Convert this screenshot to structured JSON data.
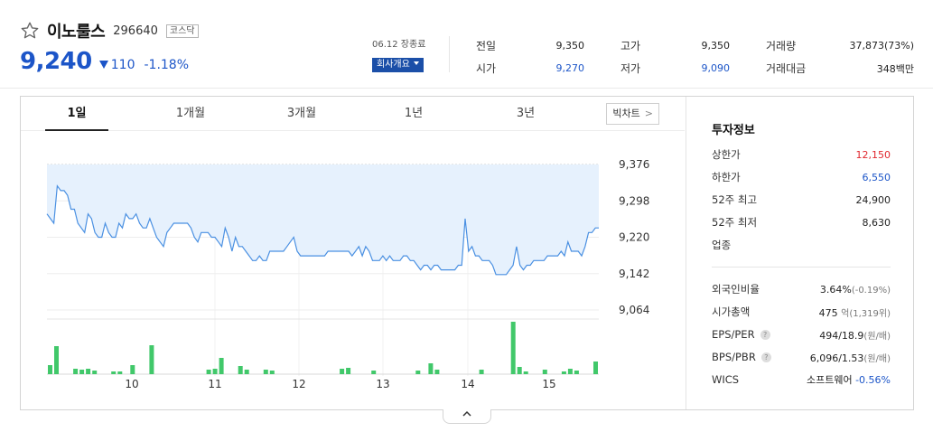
{
  "stock": {
    "name": "이노룰스",
    "code": "296640",
    "market": "코스닥",
    "price": "9,240",
    "change": "110",
    "change_pct": "-1.18%",
    "time": "06.12 장종료",
    "corp_info_label": "회사개요"
  },
  "summary": {
    "left": [
      {
        "label": "전일",
        "value": "9,350"
      },
      {
        "label": "시가",
        "value": "9,270"
      }
    ],
    "mid": [
      {
        "label": "고가",
        "value": "9,350"
      },
      {
        "label": "저가",
        "value": "9,090"
      }
    ],
    "right": [
      {
        "label": "거래량",
        "value": "37,873(73%)"
      },
      {
        "label": "거래대금",
        "value": "348백만"
      }
    ]
  },
  "tabs": [
    "1일",
    "1개월",
    "3개월",
    "1년",
    "3년"
  ],
  "big_chart_label": "빅차트",
  "invest": {
    "title": "투자정보",
    "rows": [
      {
        "label": "상한가",
        "value": "12,150"
      },
      {
        "label": "하한가",
        "value": "6,550"
      },
      {
        "label": "52주 최고",
        "value": "24,900"
      },
      {
        "label": "52주 최저",
        "value": "8,630"
      },
      {
        "label": "업종",
        "value": ""
      }
    ],
    "rows2": [
      {
        "label": "외국인비율",
        "value": "3.64%",
        "sub": "(-0.19%)"
      },
      {
        "label": "시가총액",
        "value": "475",
        "sub": "억(1,319위)"
      },
      {
        "label": "EPS/PER",
        "value": "494/18.9",
        "sub": "(원/배)"
      },
      {
        "label": "BPS/PBR",
        "value": "6,096/1.53",
        "sub": "(원/배)"
      },
      {
        "label": "WICS",
        "value": "소프트웨어",
        "sub2": "-0.56%"
      }
    ]
  },
  "colors": {
    "accent": "#1c55c8",
    "up": "#e0262d",
    "line": "#4a90e2",
    "fill": "#e6f1fd",
    "volume": "#41c86a"
  },
  "chart_data": {
    "type": "line",
    "x_labels": [
      "10",
      "11",
      "12",
      "13",
      "14",
      "15"
    ],
    "y_ticks": [
      "9,376",
      "9,298",
      "9,220",
      "9,142",
      "9,064"
    ],
    "ylim": [
      9064,
      9376
    ],
    "price_series": [
      9270,
      9260,
      9250,
      9330,
      9320,
      9320,
      9310,
      9280,
      9280,
      9250,
      9240,
      9230,
      9270,
      9260,
      9230,
      9220,
      9220,
      9250,
      9230,
      9220,
      9220,
      9250,
      9240,
      9270,
      9260,
      9260,
      9270,
      9250,
      9240,
      9240,
      9260,
      9240,
      9220,
      9210,
      9200,
      9230,
      9240,
      9250,
      9250,
      9250,
      9250,
      9250,
      9240,
      9220,
      9210,
      9230,
      9230,
      9230,
      9220,
      9220,
      9210,
      9200,
      9240,
      9220,
      9190,
      9220,
      9200,
      9200,
      9190,
      9180,
      9170,
      9170,
      9180,
      9170,
      9170,
      9190,
      9190,
      9190,
      9190,
      9190,
      9200,
      9210,
      9220,
      9190,
      9180,
      9180,
      9180,
      9180,
      9180,
      9180,
      9180,
      9180,
      9190,
      9190,
      9190,
      9190,
      9190,
      9190,
      9190,
      9180,
      9190,
      9200,
      9180,
      9200,
      9190,
      9170,
      9170,
      9170,
      9180,
      9170,
      9180,
      9170,
      9170,
      9170,
      9180,
      9180,
      9170,
      9170,
      9160,
      9150,
      9160,
      9160,
      9150,
      9160,
      9160,
      9150,
      9150,
      9150,
      9150,
      9150,
      9160,
      9160,
      9260,
      9190,
      9200,
      9180,
      9180,
      9170,
      9170,
      9170,
      9160,
      9140,
      9140,
      9140,
      9140,
      9150,
      9160,
      9200,
      9160,
      9150,
      9160,
      9160,
      9170,
      9170,
      9170,
      9170,
      9180,
      9180,
      9180,
      9180,
      9190,
      9180,
      9210,
      9190,
      9190,
      9190,
      9180,
      9200,
      9230,
      9230,
      9240,
      9240
    ]
  }
}
